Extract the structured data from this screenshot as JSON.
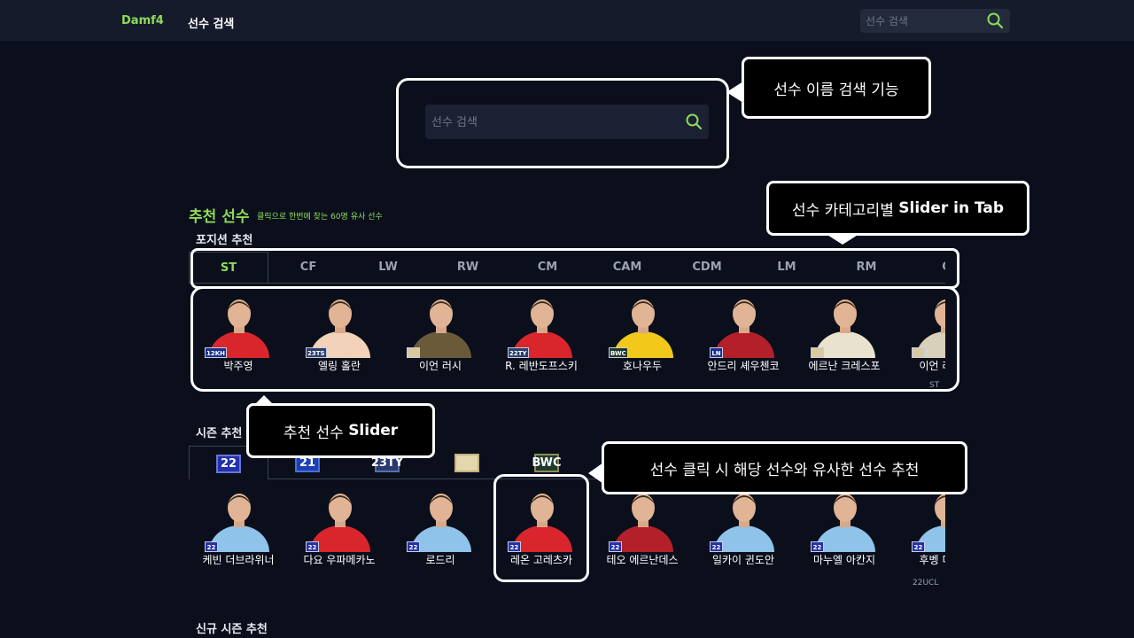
{
  "nav": {
    "brand": "Damf4",
    "link": "선수 검색",
    "search_placeholder": "선수 검색"
  },
  "search": {
    "placeholder": "선수 검색"
  },
  "recommend": {
    "title": "추천 선수",
    "subtitle": "클릭으로 한번에 찾는 60명 유사 선수"
  },
  "position_section": {
    "heading": "포지션 추천",
    "tabs": [
      "ST",
      "CF",
      "LW",
      "RW",
      "CM",
      "CAM",
      "CDM",
      "LM",
      "RM",
      "C"
    ],
    "active_tab": "ST",
    "players": [
      {
        "name": "박주영",
        "badge": "12KH",
        "badge_color": "#1b2f8f",
        "jersey": "#d8262c"
      },
      {
        "name": "엘링 홀란",
        "badge": "23TS",
        "badge_color": "#2b3f6b",
        "jersey": "#f2d2b8"
      },
      {
        "name": "이언 러시",
        "badge": "",
        "badge_color": "#d8c9a0",
        "jersey": "#6b5a3a"
      },
      {
        "name": "R. 레반도프스키",
        "badge": "22TY",
        "badge_color": "#2b3f6b",
        "jersey": "#d8262c"
      },
      {
        "name": "호나우두",
        "badge": "BWC",
        "badge_color": "#1f3a2c",
        "jersey": "#f2c81a"
      },
      {
        "name": "안드리 셰우첸코",
        "badge": "LN",
        "badge_color": "#1b2f8f",
        "jersey": "#b3202a"
      },
      {
        "name": "에르난 크레스포",
        "badge": "",
        "badge_color": "#d8c9a0",
        "jersey": "#e9e2cf"
      },
      {
        "name": "이언 라이트",
        "badge": "",
        "badge_color": "#d8c9a0",
        "jersey": "#d8d0b8"
      }
    ],
    "row_label": "ST"
  },
  "season_section": {
    "heading": "시즌 추천",
    "tabs": [
      {
        "label": "22",
        "color": "#2431a8",
        "border": "#6a74d8"
      },
      {
        "label": "21",
        "color": "#1c3fb3",
        "border": "#4b6fd8"
      },
      {
        "label": "23TY",
        "color": "#283a70",
        "border": "#5a6fa8"
      },
      {
        "label": "",
        "color": "#e4d6ad",
        "border": "#c2b27f"
      },
      {
        "label": "BWC",
        "color": "#1e3a2b",
        "border": "#8d8a55"
      }
    ],
    "players": [
      {
        "name": "케빈 더브라위너",
        "badge": "22",
        "jersey": "#8fc3ea"
      },
      {
        "name": "다요 우파메카노",
        "badge": "22",
        "jersey": "#d8262c"
      },
      {
        "name": "로드리",
        "badge": "22",
        "jersey": "#8fc3ea"
      },
      {
        "name": "레온 고레츠카",
        "badge": "22",
        "jersey": "#d8262c"
      },
      {
        "name": "테오 에르난데스",
        "badge": "22",
        "jersey": "#b3202a"
      },
      {
        "name": "일카이 귄도안",
        "badge": "22",
        "jersey": "#8fc3ea"
      },
      {
        "name": "마누엘 아칸지",
        "badge": "22",
        "jersey": "#8fc3ea"
      },
      {
        "name": "후벵 디아스",
        "badge": "22",
        "jersey": "#8fc3ea"
      }
    ],
    "row_label": "22UCL"
  },
  "new_season_section": {
    "heading": "신규 시즌 추천"
  },
  "annotations": {
    "search_feature": "선수 이름 검색 기능",
    "tab_slider_prefix": "선수 카테고리별 ",
    "tab_slider_bold": "Slider in Tab",
    "slider_prefix": "추천 선수 ",
    "slider_bold": "Slider",
    "click_recommend": "선수 클릭 시 해당 선수와 유사한 선수 추천"
  },
  "colors": {
    "accent": "#8ddb5a",
    "background": "#0b0f1c",
    "navbar": "#161b2b"
  }
}
